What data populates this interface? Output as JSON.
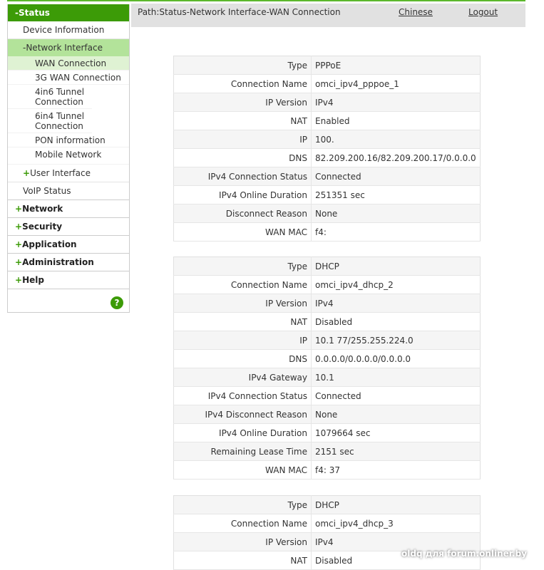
{
  "sidebar": {
    "status": "-Status",
    "device_info": "Device Information",
    "network_interface": "-Network Interface",
    "subs": [
      "WAN Connection",
      "3G WAN Connection",
      "4in6 Tunnel Connection",
      "6in4 Tunnel Connection",
      "PON information",
      "Mobile Network"
    ],
    "user_interface": "User Interface",
    "voip": "VoIP Status",
    "network": "Network",
    "security": "Security",
    "application": "Application",
    "administration": "Administration",
    "help": "Help",
    "help_icon": "?",
    "plus": "+"
  },
  "header": {
    "path": "Path:Status-Network Interface-WAN Connection",
    "chinese": "Chinese",
    "logout": "Logout"
  },
  "tables": [
    [
      [
        "Type",
        "PPPoE"
      ],
      [
        "Connection Name",
        "omci_ipv4_pppoe_1"
      ],
      [
        "IP Version",
        "IPv4"
      ],
      [
        "NAT",
        "Enabled"
      ],
      [
        "IP",
        "100."
      ],
      [
        "DNS",
        "82.209.200.16/82.209.200.17/0.0.0.0"
      ],
      [
        "IPv4 Connection Status",
        "Connected"
      ],
      [
        "IPv4 Online Duration",
        "251351 sec"
      ],
      [
        "Disconnect Reason",
        "None"
      ],
      [
        "WAN MAC",
        "f4:"
      ]
    ],
    [
      [
        "Type",
        "DHCP"
      ],
      [
        "Connection Name",
        "omci_ipv4_dhcp_2"
      ],
      [
        "IP Version",
        "IPv4"
      ],
      [
        "NAT",
        "Disabled"
      ],
      [
        "IP",
        "10.1 77/255.255.224.0"
      ],
      [
        "DNS",
        "0.0.0.0/0.0.0.0/0.0.0.0"
      ],
      [
        "IPv4 Gateway",
        "10.1"
      ],
      [
        "IPv4 Connection Status",
        "Connected"
      ],
      [
        "IPv4 Disconnect Reason",
        "None"
      ],
      [
        "IPv4 Online Duration",
        "1079664 sec"
      ],
      [
        "Remaining Lease Time",
        "2151 sec"
      ],
      [
        "WAN MAC",
        "f4: 37"
      ]
    ],
    [
      [
        "Type",
        "DHCP"
      ],
      [
        "Connection Name",
        "omci_ipv4_dhcp_3"
      ],
      [
        "IP Version",
        "IPv4"
      ],
      [
        "NAT",
        "Disabled"
      ]
    ]
  ],
  "watermark": "oldq для forum.onliner.by"
}
